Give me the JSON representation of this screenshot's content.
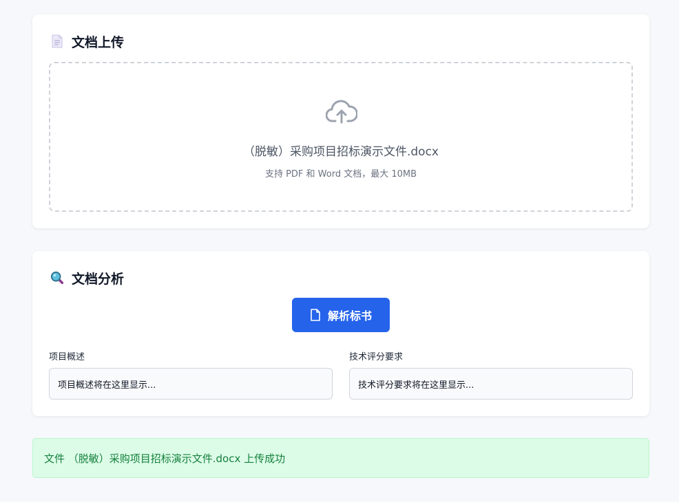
{
  "upload_section": {
    "title": "文档上传",
    "title_icon": "document-icon",
    "dropzone": {
      "icon": "cloud-upload-icon",
      "filename": "（脱敏）采购项目招标演示文件.docx",
      "hint": "支持 PDF 和 Word 文档，最大 10MB"
    }
  },
  "analysis_section": {
    "title": "文档分析",
    "title_icon": "magnifier-icon",
    "parse_button": {
      "label": "解析标书",
      "icon": "file-icon"
    },
    "fields": [
      {
        "label": "项目概述",
        "placeholder": "项目概述将在这里显示..."
      },
      {
        "label": "技术评分要求",
        "placeholder": "技术评分要求将在这里显示..."
      }
    ]
  },
  "status": {
    "message": "文件 （脱敏）采购项目招标演示文件.docx 上传成功",
    "type": "success"
  },
  "colors": {
    "primary": "#2563eb",
    "success_bg": "#dcfce7",
    "success_text": "#15803d",
    "page_bg": "#f7f8fb"
  }
}
